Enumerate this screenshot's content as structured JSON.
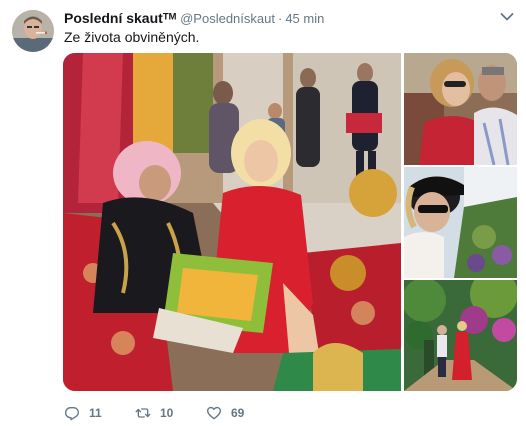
{
  "tweet": {
    "display_name": "Poslední skautᵀᴹ",
    "handle": "@Poslednískaut",
    "separator": "·",
    "timestamp": "45 min",
    "text": "Ze života obviněných.",
    "media": [
      {
        "name": "market-photo-main"
      },
      {
        "name": "couple-photo"
      },
      {
        "name": "woman-sunglasses-photo"
      },
      {
        "name": "garden-photo"
      }
    ],
    "actions": {
      "reply": {
        "icon": "reply-icon",
        "count": "11"
      },
      "retweet": {
        "icon": "retweet-icon",
        "count": "10"
      },
      "like": {
        "icon": "heart-icon",
        "count": "69"
      }
    },
    "menu_icon": "chevron-down-icon"
  },
  "colors": {
    "text": "#14171a",
    "secondary": "#657786",
    "background": "#ffffff"
  }
}
